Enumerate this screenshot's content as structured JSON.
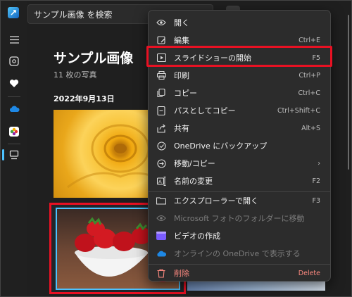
{
  "search": {
    "placeholder": "サンプル画像 を検索"
  },
  "main": {
    "title": "サンプル画像",
    "count": "11 枚の写真",
    "date": "2022年9月13日"
  },
  "menu": {
    "items": [
      {
        "label": "開く",
        "shortcut": "",
        "icon": "eye-icon"
      },
      {
        "label": "編集",
        "shortcut": "Ctrl+E",
        "icon": "edit-image-icon"
      },
      {
        "label": "スライドショーの開始",
        "shortcut": "F5",
        "icon": "slideshow-icon"
      },
      {
        "label": "印刷",
        "shortcut": "Ctrl+P",
        "icon": "printer-icon"
      },
      {
        "label": "コピー",
        "shortcut": "Ctrl+C",
        "icon": "copy-icon"
      },
      {
        "label": "パスとしてコピー",
        "shortcut": "Ctrl+Shift+C",
        "icon": "copy-path-icon"
      },
      {
        "label": "共有",
        "shortcut": "Alt+S",
        "icon": "share-icon"
      },
      {
        "label": "OneDrive にバックアップ",
        "shortcut": "",
        "icon": "sync-icon"
      },
      {
        "label": "移動/コピー",
        "shortcut": "",
        "icon": "move-icon"
      },
      {
        "label": "名前の変更",
        "shortcut": "F2",
        "icon": "rename-icon"
      },
      {
        "label": "エクスプローラーで開く",
        "shortcut": "F3",
        "icon": "folder-icon"
      },
      {
        "label": "Microsoft フォトのフォルダーに移動",
        "shortcut": "",
        "icon": "eye-disabled-icon"
      },
      {
        "label": "ビデオの作成",
        "shortcut": "",
        "icon": "video-editor-icon"
      },
      {
        "label": "オンラインの OneDrive で表示する",
        "shortcut": "",
        "icon": "cloud-icon"
      },
      {
        "label": "削除",
        "shortcut": "Delete",
        "icon": "trash-icon"
      }
    ]
  },
  "colors": {
    "accent": "#4cc2ff",
    "highlight": "#e81123",
    "danger": "#ff8a80"
  }
}
